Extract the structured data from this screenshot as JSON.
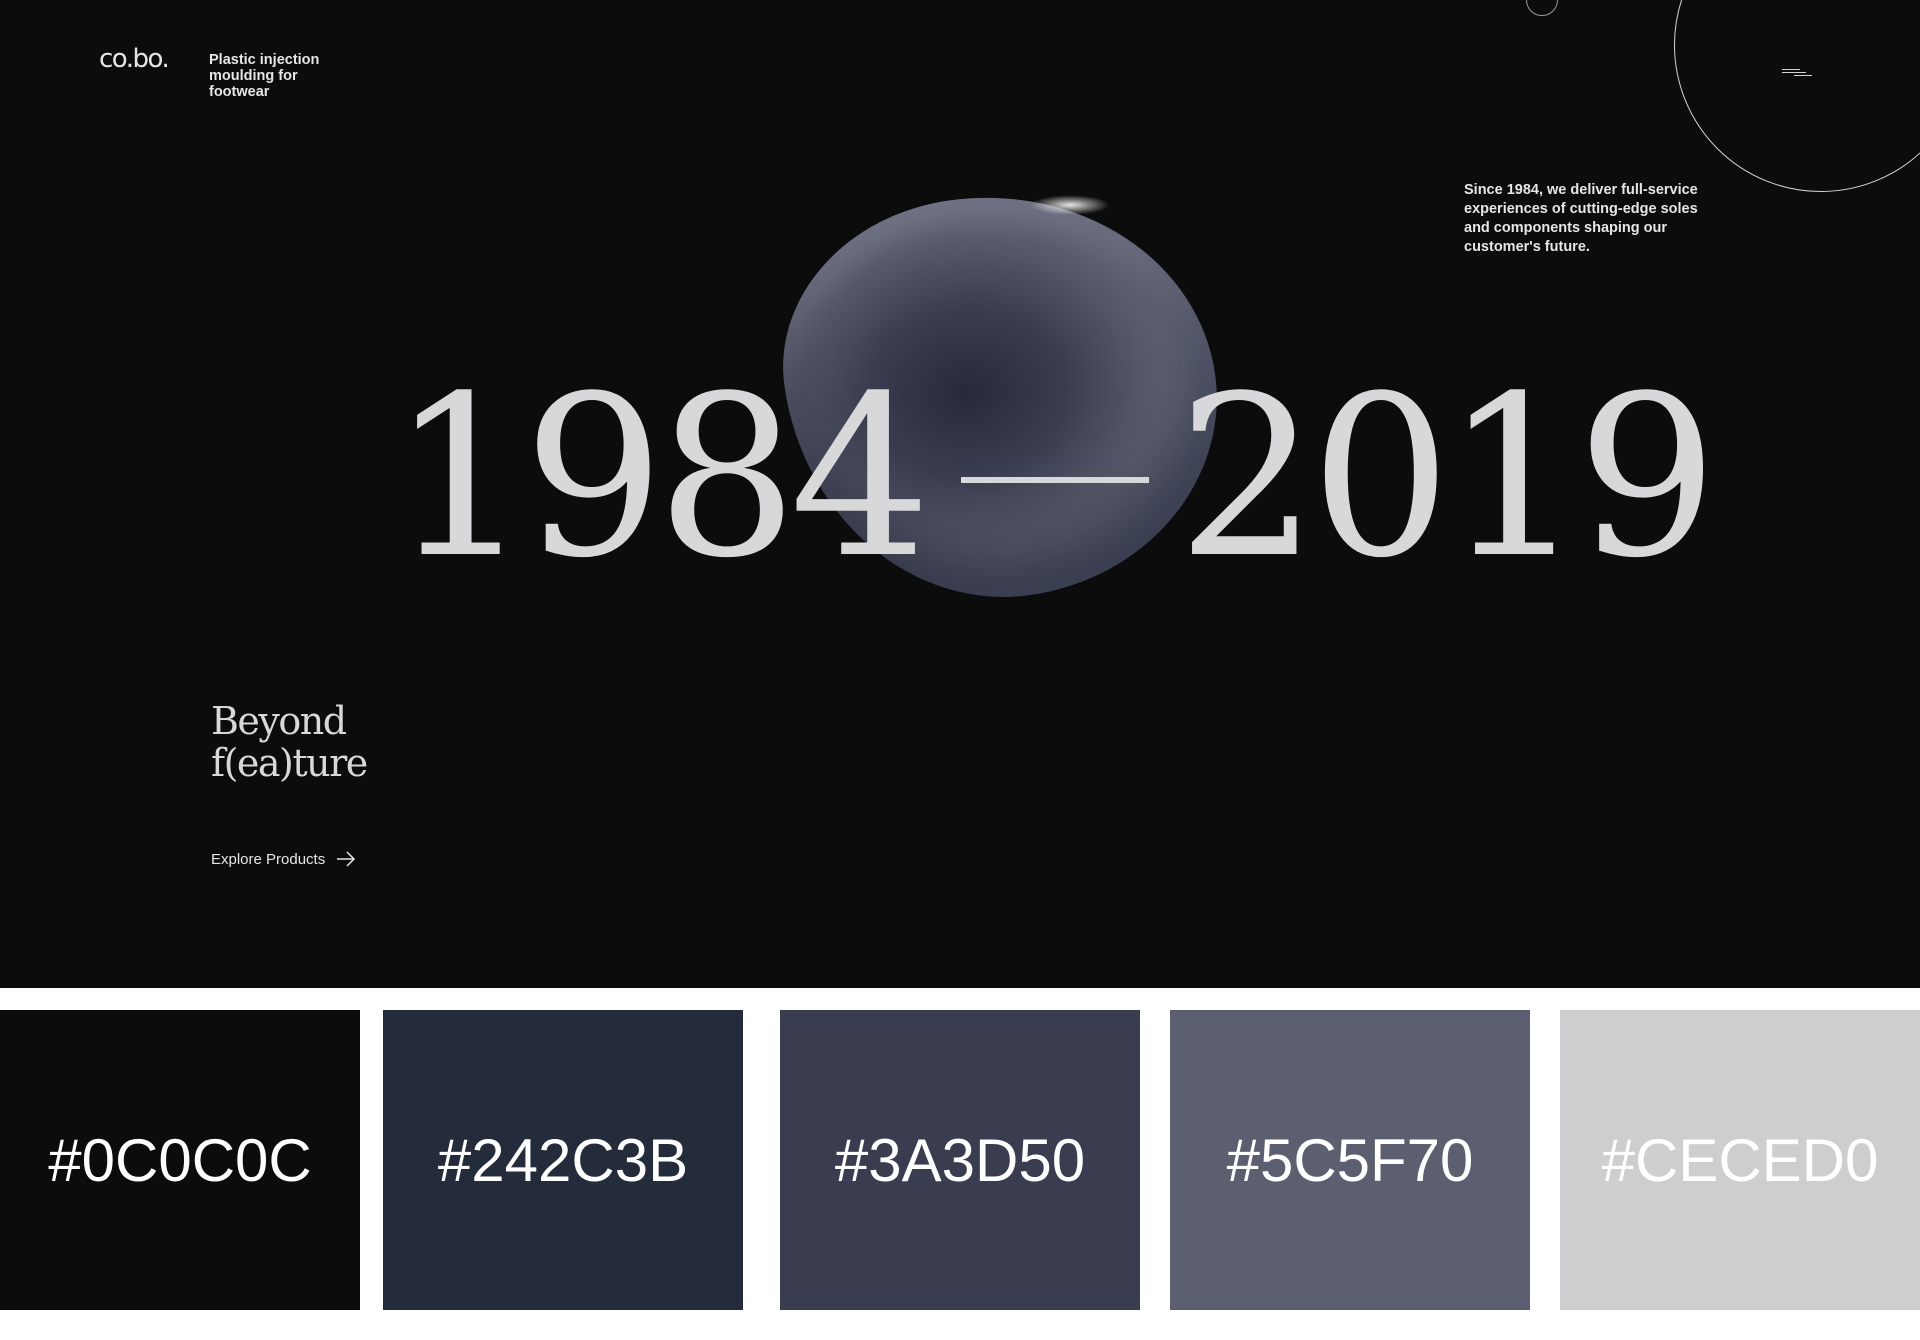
{
  "brand": {
    "logo": "co.bo.",
    "tagline": [
      "Plastic injection",
      "moulding for",
      "footwear"
    ]
  },
  "intro_text": "Since 1984, we deliver full-service experiences of cutting-edge soles and components shaping our customer's future.",
  "menu": {
    "icon": "hamburger-menu-icon"
  },
  "hero": {
    "year_start": "1984",
    "year_end": "2019",
    "subhead_line1": "Beyond",
    "subhead_line2": "f(ea)ture",
    "cta_label": "Explore Products",
    "cta_icon": "arrow-right-icon"
  },
  "colors": {
    "background": "#0c0c0c",
    "text": "#d8d8da"
  },
  "palette": {
    "swatches": [
      {
        "label": "#0C0C0C",
        "color": "#0C0C0C"
      },
      {
        "label": "#242C3B",
        "color": "#242C3B"
      },
      {
        "label": "#3A3D50",
        "color": "#3A3D50"
      },
      {
        "label": "#5C5F70",
        "color": "#5C5F70"
      },
      {
        "label": "#CECED0",
        "color": "#CECED0"
      }
    ]
  }
}
